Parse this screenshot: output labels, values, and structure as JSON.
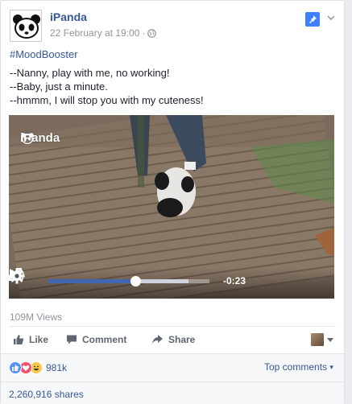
{
  "post": {
    "page_name": "iPanda",
    "timestamp": "22 February at 19:00",
    "separator": "·",
    "hashtag": "#MoodBooster",
    "lines": [
      "--Nanny, play with me, no working!",
      "--Baby, just a minute.",
      "--hmmm, I will stop you with my cuteness!"
    ]
  },
  "video": {
    "watermark": "iPanda",
    "time_remaining": "-0:23",
    "progress_fraction": 0.54,
    "buffered_fraction": 0.87
  },
  "stats": {
    "views": "109M Views",
    "reaction_count": "981k",
    "top_comments": "Top comments",
    "shares": "2,260,916 shares"
  },
  "actions": {
    "like": "Like",
    "comment": "Comment",
    "share": "Share"
  },
  "colors": {
    "link": "#365899",
    "accent": "#4267b2",
    "pin": "#4080ff"
  },
  "icons": [
    "panda-logo-icon",
    "globe-icon",
    "pin-icon",
    "chevron-down-icon",
    "play-icon",
    "volume-icon",
    "gear-icon",
    "fullscreen-icon",
    "like-icon",
    "comment-icon",
    "share-icon",
    "like-reaction-icon",
    "love-reaction-icon",
    "haha-reaction-icon"
  ]
}
